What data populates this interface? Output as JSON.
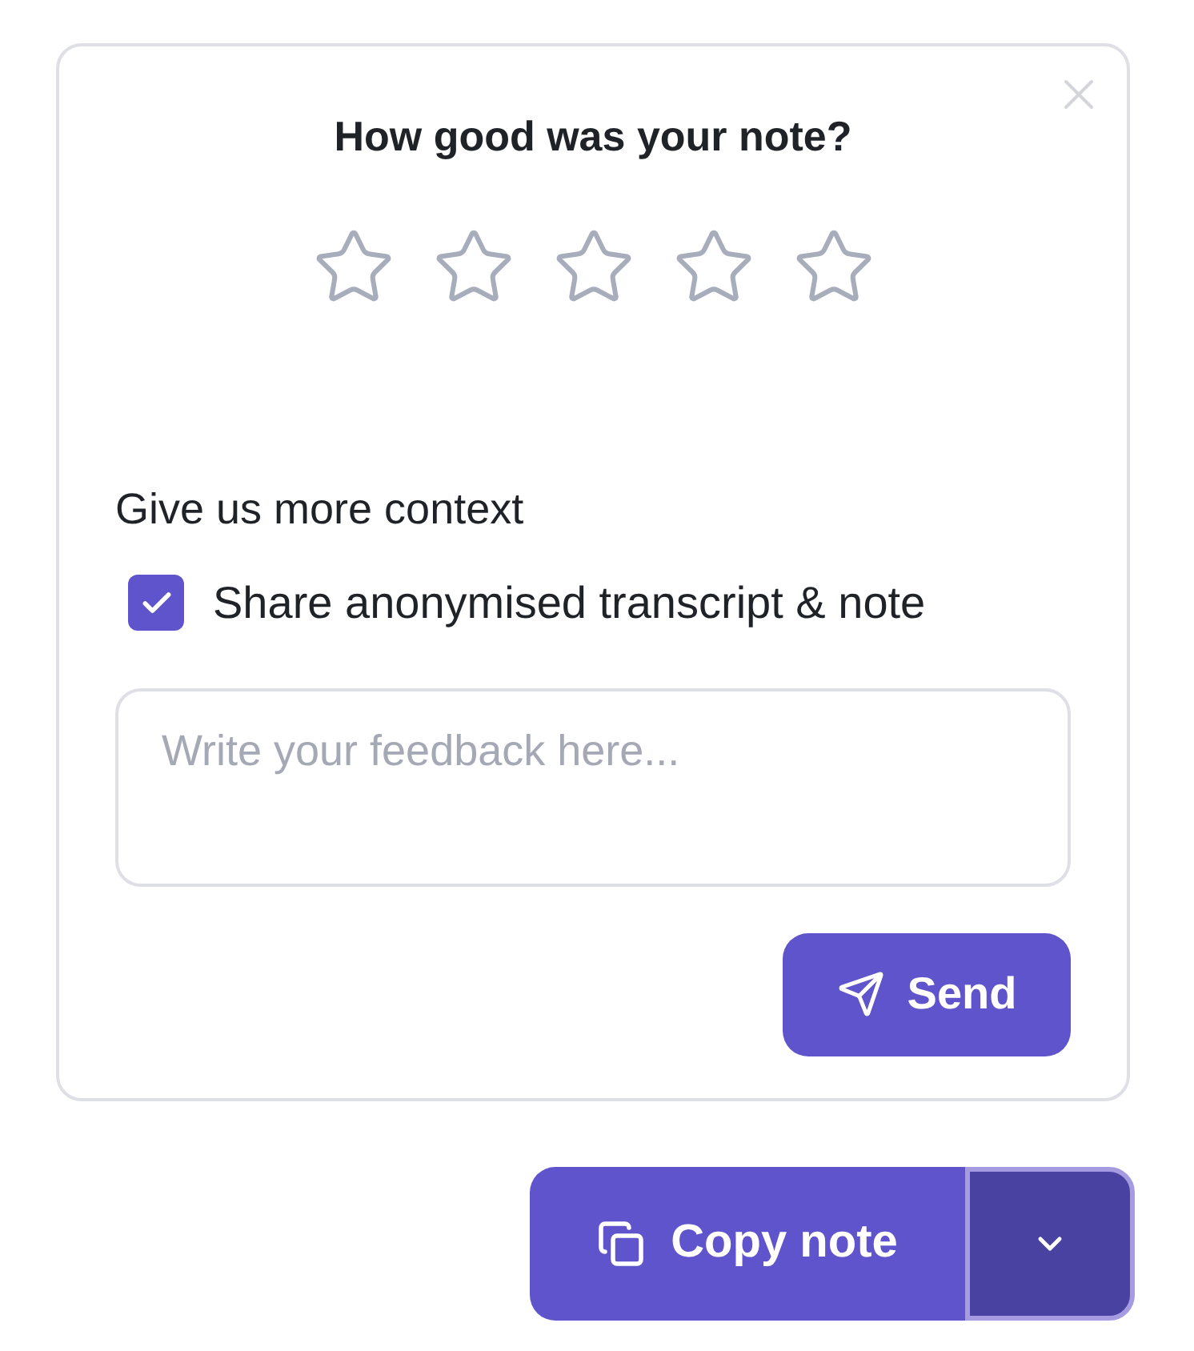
{
  "feedback_card": {
    "title": "How good was your note?",
    "rating": {
      "stars": 0
    },
    "context_heading": "Give us more context",
    "share_checkbox": {
      "label": "Share anonymised transcript & note",
      "checked": true
    },
    "feedback_field": {
      "placeholder": "Write your feedback here..."
    },
    "send_button": "Send"
  },
  "copy_button": "Copy note",
  "menu_toggle": {
    "focused": true
  }
}
